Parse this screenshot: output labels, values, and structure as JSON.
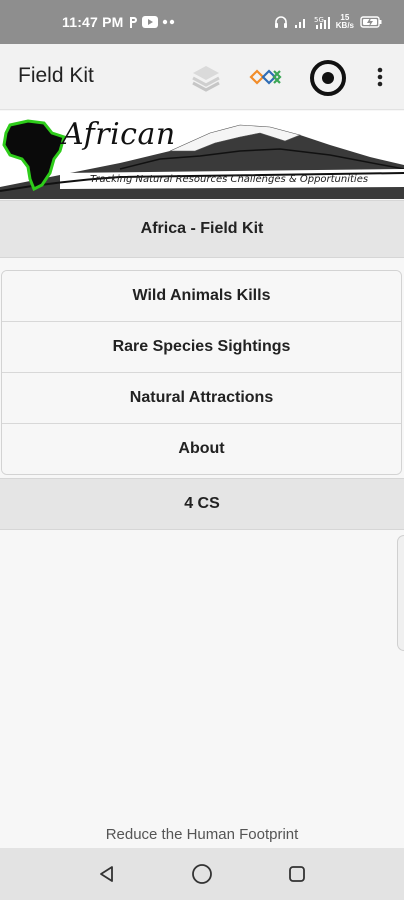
{
  "status_bar": {
    "time": "11:47 PM",
    "left_icons": [
      "p-icon",
      "youtube-icon",
      "dots-icon"
    ],
    "network_speed_top": "15",
    "network_speed_bottom": "KB/s",
    "right_icons": [
      "headset-icon",
      "signal-icon",
      "signal-5g-icon",
      "battery-icon"
    ]
  },
  "app_bar": {
    "title": "Field Kit",
    "actions": [
      "layers-icon",
      "odk-logo-icon",
      "target-icon",
      "more-vert-icon"
    ]
  },
  "banner": {
    "title": "African",
    "tagline": "Tracking Natural Resources Challenges & Opportunities"
  },
  "header": {
    "label": "Africa - Field Kit"
  },
  "menu": {
    "items": [
      {
        "label": "Wild Animals Kills"
      },
      {
        "label": "Rare Species Sightings"
      },
      {
        "label": "Natural Attractions"
      },
      {
        "label": "About"
      }
    ]
  },
  "footer_header": {
    "label": "4 CS"
  },
  "footer": {
    "text": "Reduce the Human Footprint"
  },
  "nav_bar": {
    "buttons": [
      "back-icon",
      "home-icon",
      "recents-icon"
    ]
  },
  "colors": {
    "status_bar_bg": "#8e8e8e",
    "app_bar_bg": "#f2f2f2",
    "header_bg": "#e5e5e5",
    "page_bg": "#f7f7f7",
    "africa_glow": "#2ecc1a",
    "odk_orange": "#f28c28",
    "odk_blue": "#2f6db5",
    "odk_green": "#3aa655"
  }
}
